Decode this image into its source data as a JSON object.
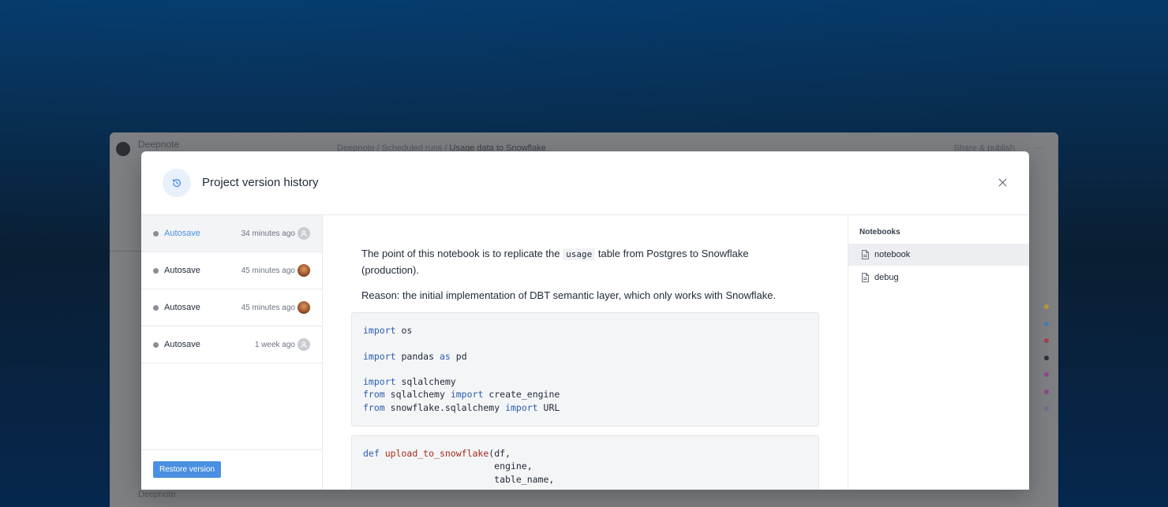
{
  "background_app": {
    "app_name": "Deepnote",
    "breadcrumb_root": "Deepnote",
    "breadcrumb_folder": "Scheduled runs",
    "breadcrumb_page": "Usage data to Snowflake",
    "share_label": "Share & publish",
    "footer_label": "Deepnote"
  },
  "modal": {
    "title": "Project version history",
    "header_icon": "history-icon",
    "close_icon": "close-icon"
  },
  "versions": [
    {
      "label": "Autosave",
      "time": "34 minutes ago",
      "avatar": "default-avatar",
      "active": true
    },
    {
      "label": "Autosave",
      "time": "45 minutes ago",
      "avatar": "photo-avatar",
      "active": false
    },
    {
      "label": "Autosave",
      "time": "45 minutes ago",
      "avatar": "photo-avatar",
      "active": false
    },
    {
      "label": "Autosave",
      "time": "1 week ago",
      "avatar": "default-avatar",
      "active": false
    }
  ],
  "restore_label": "Restore version",
  "content": {
    "para1_before": "The point of this notebook is to replicate the ",
    "para1_code": "usage",
    "para1_after": " table from Postgres to Snowflake (production).",
    "para2": "Reason: the initial implementation of DBT semantic layer, which only works with Snowflake.",
    "code1": [
      [
        [
          "kw",
          "import"
        ],
        [
          "",
          "os"
        ]
      ],
      [],
      [
        [
          "kw",
          "import"
        ],
        [
          "",
          "pandas"
        ],
        [
          "kw",
          "as"
        ],
        [
          "",
          "pd"
        ]
      ],
      [],
      [
        [
          "kw",
          "import"
        ],
        [
          "",
          "sqlalchemy"
        ]
      ],
      [
        [
          "kw",
          "from"
        ],
        [
          "",
          "sqlalchemy"
        ],
        [
          "kw",
          "import"
        ],
        [
          "",
          "create_engine"
        ]
      ],
      [
        [
          "kw",
          "from"
        ],
        [
          "",
          "snowflake.sqlalchemy"
        ],
        [
          "kw",
          "import"
        ],
        [
          "",
          "URL"
        ]
      ]
    ],
    "code2_def": "def",
    "code2_fn": "upload_to_snowflake",
    "code2_arg1": "(df,",
    "code2_arg2": "engine,",
    "code2_arg3": "table_name,"
  },
  "notebooks": {
    "heading": "Notebooks",
    "items": [
      {
        "label": "notebook",
        "active": true
      },
      {
        "label": "debug",
        "active": false
      }
    ]
  },
  "colors": {
    "accent": "#4a90e2",
    "keyword": "#2a5db0",
    "function": "#a62a1a"
  }
}
